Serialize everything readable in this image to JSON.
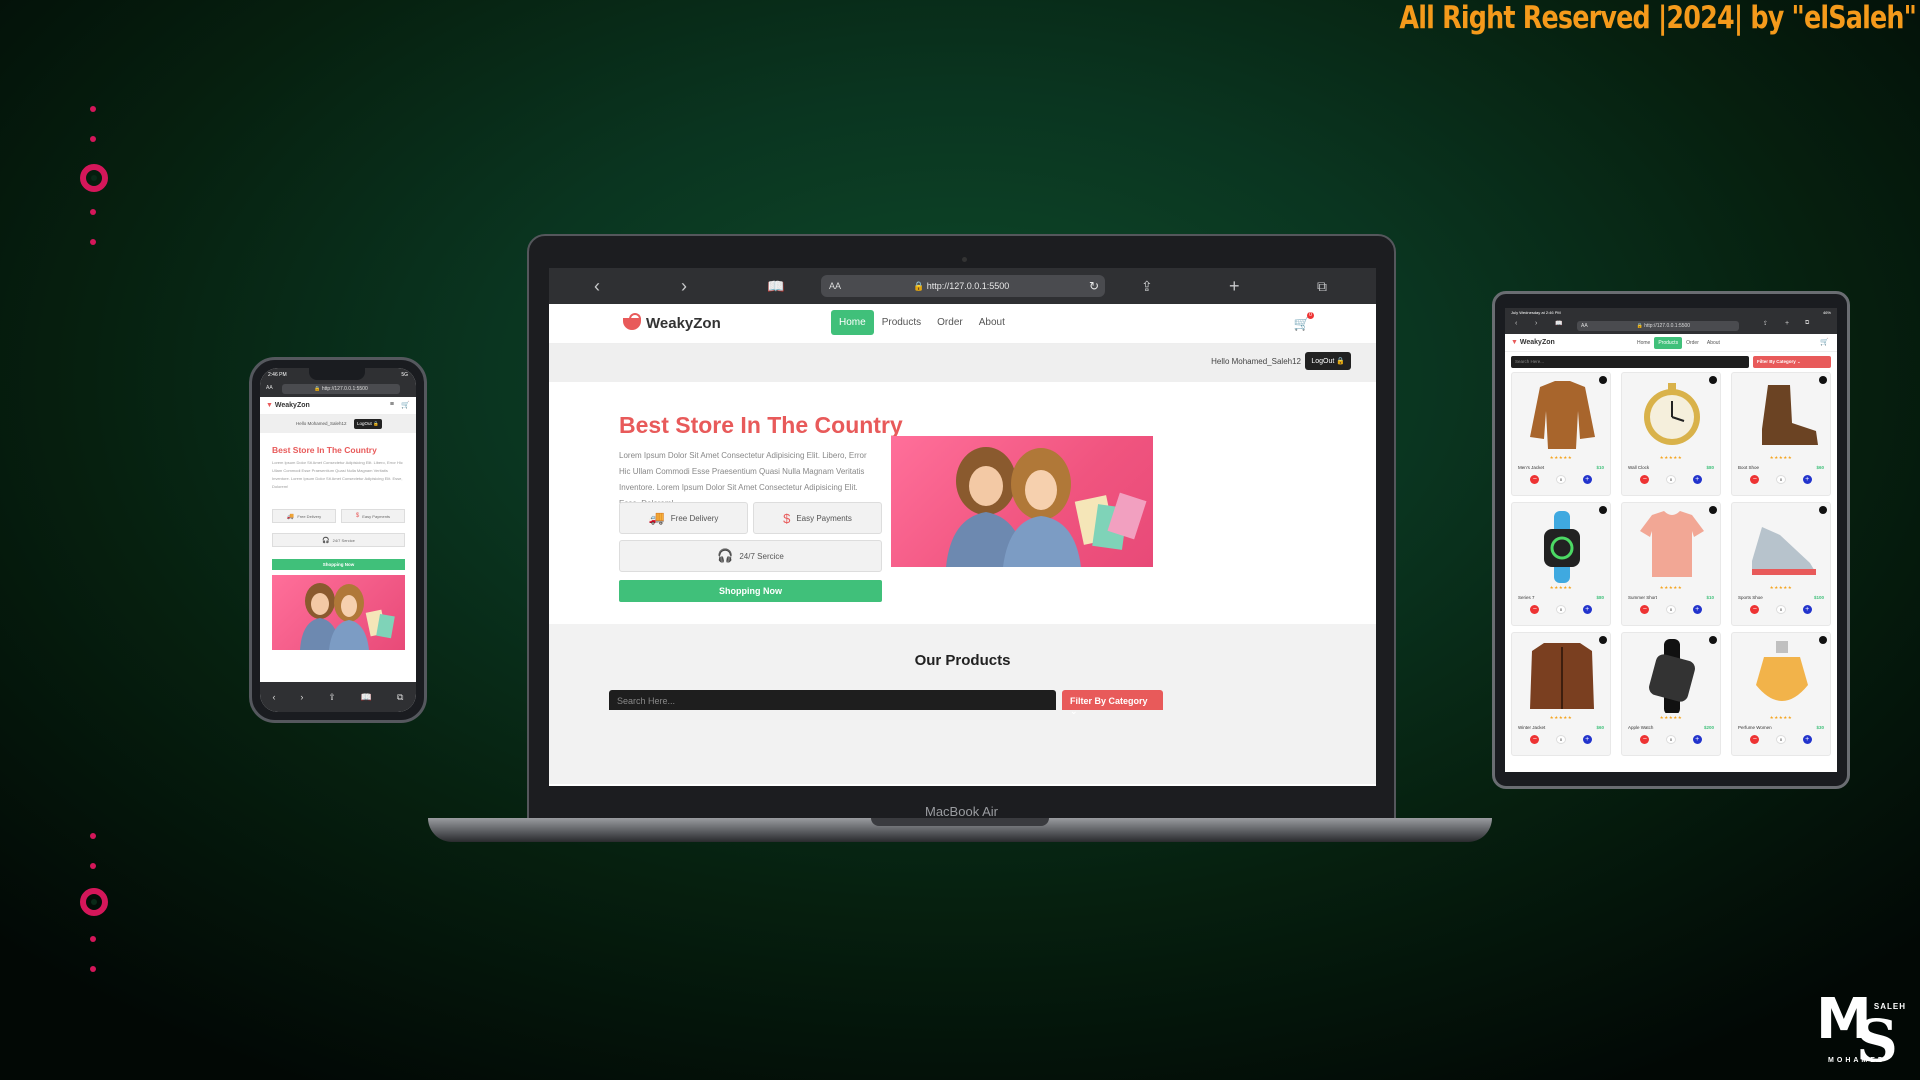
{
  "copyright": "All Right Reserved |2024| by \"elSaleh\"",
  "brand_logo": {
    "initials": "MS",
    "top": "SALEH",
    "bottom": "MOHAMED"
  },
  "laptop": {
    "label": "MacBook Air",
    "browser": {
      "text_size": "AA",
      "url": "http://127.0.0.1:5500"
    },
    "site": {
      "brand": "WeakyZon",
      "nav": [
        "Home",
        "Products",
        "Order",
        "About"
      ],
      "active_nav": "Home",
      "cart_count": "0",
      "greeting": "Hello Mohamed_Saleh12",
      "logout": "LogOut",
      "hero": {
        "title": "Best Store In The Country",
        "description": "Lorem Ipsum Dolor Sit Amet Consectetur Adipisicing Elit. Libero, Error Hic Ullam Commodi Esse Praesentium Quasi Nulla Magnam Veritatis Inventore. Lorem Ipsum Dolor Sit Amet Consectetur Adipisicing Elit. Esse, Dolorem!",
        "features": [
          "Free Delivery",
          "Easy Payments",
          "24/7 Sercice"
        ],
        "cta": "Shopping Now"
      },
      "products_section": {
        "title": "Our Products",
        "search_placeholder": "Search Here...",
        "filter": "Filter By Category"
      }
    }
  },
  "phone": {
    "time": "2:46 PM",
    "status_right": "5G",
    "url": "http://127.0.0.1:5500",
    "text_size": "AA",
    "brand": "WeakyZon",
    "greeting": "Hello Mohamed_Saleh12",
    "logout": "LogOut",
    "title": "Best Store In The Country",
    "description": "Lorem Ipsum Dolor Sit Amet Consectetur Adipisicing Elit. Libero, Error Hic Ullam Commodi Esse Praesentium Quasi Nulla Magnam Veritatis Inventore. Lorem Ipsum Dolor Sit Amet Consectetur Adipisicing Elit. Esse, Dolorem!",
    "features": [
      "Free Delivery",
      "Easy Payments",
      "24/7 Sercice"
    ],
    "cta": "Shopping Now"
  },
  "tablet": {
    "status_left": "July Wednesday at 2:46 PM",
    "status_right": "46%",
    "url": "http://127.0.0.1:5500",
    "text_size": "AA",
    "brand": "WeakyZon",
    "nav": [
      "Home",
      "Products",
      "Order",
      "About"
    ],
    "active_nav": "Products",
    "search_placeholder": "Search Here...",
    "filter": "Filter By Category",
    "stars": "★★★★★",
    "products": [
      {
        "name": "Men's Jacket",
        "price": "$10",
        "qty": "0",
        "icon": "jacket-icon",
        "color": "#a8652c"
      },
      {
        "name": "Wall Clock",
        "price": "$80",
        "qty": "0",
        "icon": "clock-icon",
        "color": "#d9b24a"
      },
      {
        "name": "Boot Shoe",
        "price": "$60",
        "qty": "0",
        "icon": "boot-icon",
        "color": "#6b4323"
      },
      {
        "name": "Series 7",
        "price": "$80",
        "qty": "0",
        "icon": "watch-icon",
        "color": "#3fa9e0"
      },
      {
        "name": "Summer Short",
        "price": "$10",
        "qty": "0",
        "icon": "tshirt-icon",
        "color": "#f2a795"
      },
      {
        "name": "Sports Shoe",
        "price": "$100",
        "qty": "0",
        "icon": "sneaker-icon",
        "color": "#b7c3cc"
      },
      {
        "name": "Winter Jacket",
        "price": "$60",
        "qty": "0",
        "icon": "coat-icon",
        "color": "#7a3f20"
      },
      {
        "name": "Apple Watch",
        "price": "$200",
        "qty": "0",
        "icon": "smartwatch-icon",
        "color": "#333333"
      },
      {
        "name": "Perfume Women",
        "price": "$30",
        "qty": "0",
        "icon": "perfume-icon",
        "color": "#f2b34a"
      }
    ]
  },
  "colors": {
    "accent_green": "#40c07a",
    "accent_red": "#e85a5a",
    "bg_green": "#0f4a2a",
    "copyright": "#f59a1b",
    "deco_pink": "#d4175a"
  }
}
